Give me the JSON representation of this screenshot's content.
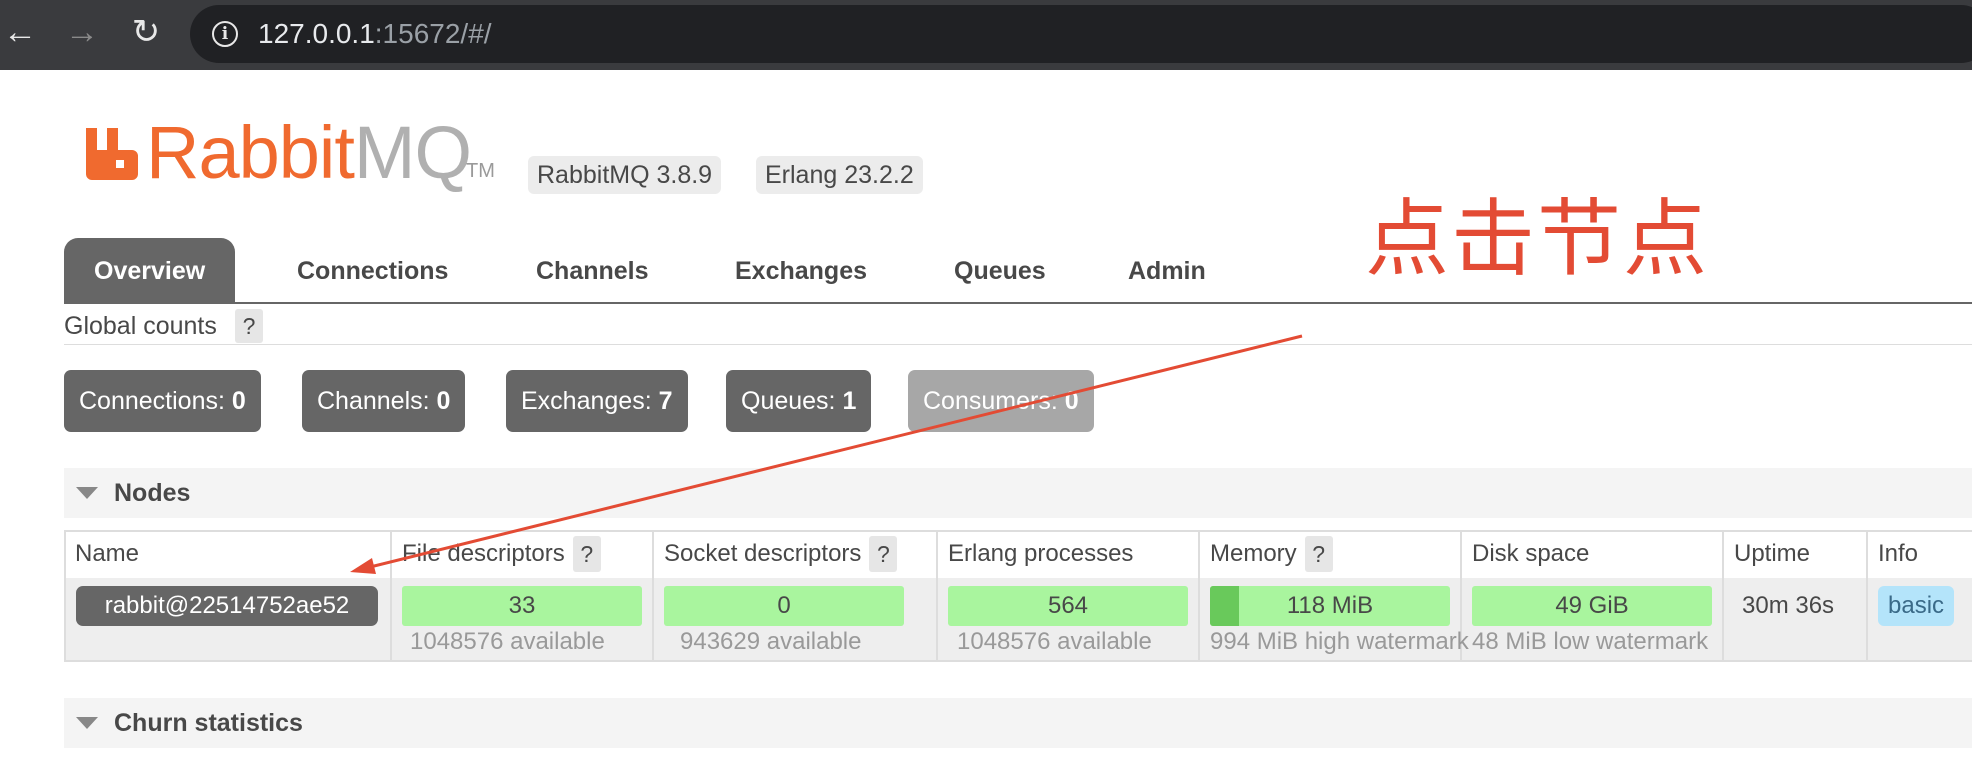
{
  "browser": {
    "url_host": "127.0.0.1",
    "url_rest": ":15672/#/",
    "back_icon": "←",
    "forward_icon": "→",
    "reload_icon": "↻",
    "info_icon": "i"
  },
  "header": {
    "logo_rabbit": "Rabbit",
    "logo_mq": "MQ",
    "logo_tm": "TM",
    "rabbitmq_version": "RabbitMQ 3.8.9",
    "erlang_version": "Erlang 23.2.2",
    "brand_color": "#f06a2f"
  },
  "tabs": [
    {
      "label": "Overview",
      "active": true
    },
    {
      "label": "Connections"
    },
    {
      "label": "Channels"
    },
    {
      "label": "Exchanges"
    },
    {
      "label": "Queues"
    },
    {
      "label": "Admin"
    }
  ],
  "annotation": {
    "text": "点击节点",
    "color": "#e34b34"
  },
  "global_counts": {
    "label": "Global counts",
    "help": "?",
    "counts": [
      {
        "label": "Connections:",
        "value": "0"
      },
      {
        "label": "Channels:",
        "value": "0"
      },
      {
        "label": "Exchanges:",
        "value": "7"
      },
      {
        "label": "Queues:",
        "value": "1"
      },
      {
        "label": "Consumers:",
        "value": "0"
      }
    ]
  },
  "nodes": {
    "section_title": "Nodes",
    "columns": {
      "name": "Name",
      "file_descriptors": "File descriptors",
      "socket_descriptors": "Socket descriptors",
      "erlang_processes": "Erlang processes",
      "memory": "Memory",
      "disk_space": "Disk space",
      "uptime": "Uptime",
      "info": "Info",
      "help": "?"
    },
    "row": {
      "name": "rabbit@22514752ae52",
      "file_descriptors": "33",
      "file_descriptors_available": "1048576 available",
      "socket_descriptors": "0",
      "socket_descriptors_available": "943629 available",
      "erlang_processes": "564",
      "erlang_processes_available": "1048576 available",
      "memory": "118 MiB",
      "memory_fraction": 0.119,
      "memory_watermark": "994 MiB high watermark",
      "disk_space": "49 GiB",
      "disk_watermark": "48 MiB low watermark",
      "uptime": "30m 36s",
      "info_badge": "basic"
    }
  },
  "churn": {
    "section_title": "Churn statistics"
  }
}
